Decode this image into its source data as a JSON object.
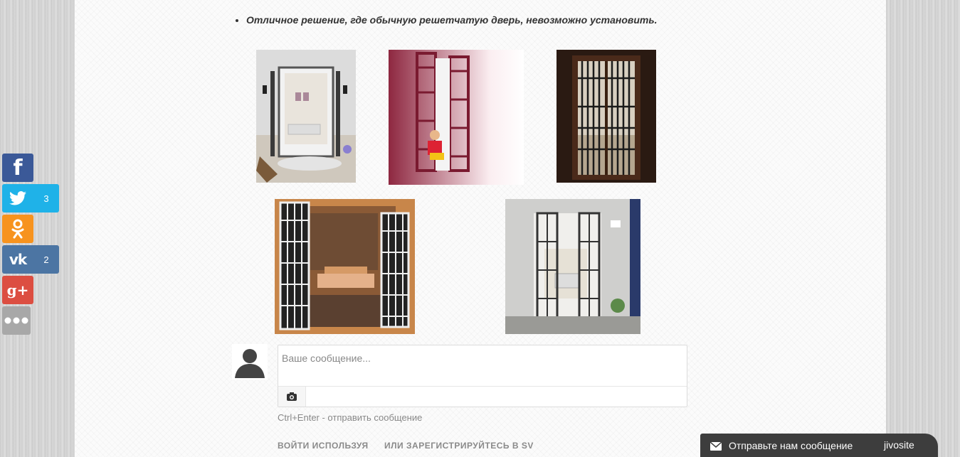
{
  "article": {
    "bullet": "Отличное решение, где обычную решетчатую дверь, невозможно установить."
  },
  "share": {
    "twitter_count": "3",
    "vk_count": "2",
    "icons": [
      "facebook-icon",
      "twitter-icon",
      "odnoklassniki-icon",
      "vk-icon",
      "google-plus-icon",
      "more-icon"
    ]
  },
  "comment": {
    "placeholder": "Ваше сообщение...",
    "hint": "Ctrl+Enter - отправить сообщение",
    "login_label": "ВОЙТИ ИСПОЛЬЗУЯ",
    "register_label": "ИЛИ ЗАРЕГИСТРИРУЙТЕСЬ В SV"
  },
  "chat": {
    "label": "Отправьте нам сообщение",
    "brand": "jivosite"
  },
  "colors": {
    "facebook": "#3b5998",
    "twitter": "#1fb2e8",
    "odnoklassniki": "#f7931e",
    "vk": "#4c75a3",
    "google_plus": "#dc4e41",
    "chat_bg": "#3d3d3d"
  }
}
